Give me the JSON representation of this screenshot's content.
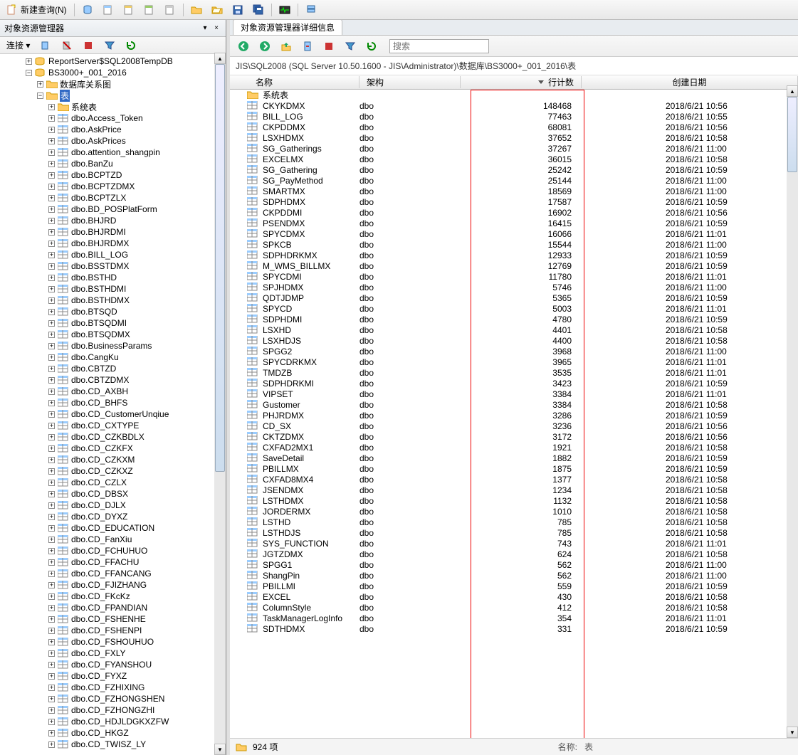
{
  "toolbar": {
    "new_query": "新建查询(N)"
  },
  "object_explorer": {
    "title": "对象资源管理器",
    "connect_label": "连接 ▾",
    "top_db": "ReportServer$SQL2008TempDB",
    "main_db": "BS3000+_001_2016",
    "diagram_folder": "数据库关系图",
    "tables_folder": "表",
    "sys_tables": "系统表",
    "items": [
      "dbo.Access_Token",
      "dbo.AskPrice",
      "dbo.AskPrices",
      "dbo.attention_shangpin",
      "dbo.BanZu",
      "dbo.BCPTZD",
      "dbo.BCPTZDMX",
      "dbo.BCPTZLX",
      "dbo.BD_POSPlatForm",
      "dbo.BHJRD",
      "dbo.BHJRDMI",
      "dbo.BHJRDMX",
      "dbo.BILL_LOG",
      "dbo.BSSTDMX",
      "dbo.BSTHD",
      "dbo.BSTHDMI",
      "dbo.BSTHDMX",
      "dbo.BTSQD",
      "dbo.BTSQDMI",
      "dbo.BTSQDMX",
      "dbo.BusinessParams",
      "dbo.CangKu",
      "dbo.CBTZD",
      "dbo.CBTZDMX",
      "dbo.CD_AXBH",
      "dbo.CD_BHFS",
      "dbo.CD_CustomerUnqiue",
      "dbo.CD_CXTYPE",
      "dbo.CD_CZKBDLX",
      "dbo.CD_CZKFX",
      "dbo.CD_CZKXM",
      "dbo.CD_CZKXZ",
      "dbo.CD_CZLX",
      "dbo.CD_DBSX",
      "dbo.CD_DJLX",
      "dbo.CD_DYXZ",
      "dbo.CD_EDUCATION",
      "dbo.CD_FanXiu",
      "dbo.CD_FCHUHUO",
      "dbo.CD_FFACHU",
      "dbo.CD_FFANCANG",
      "dbo.CD_FJIZHANG",
      "dbo.CD_FKcKz",
      "dbo.CD_FPANDIAN",
      "dbo.CD_FSHENHE",
      "dbo.CD_FSHENPI",
      "dbo.CD_FSHOUHUO",
      "dbo.CD_FXLY",
      "dbo.CD_FYANSHOU",
      "dbo.CD_FYXZ",
      "dbo.CD_FZHIXING",
      "dbo.CD_FZHONGSHEN",
      "dbo.CD_FZHONGZHI",
      "dbo.CD_HDJLDGKXZFW",
      "dbo.CD_HKGZ",
      "dbo.CD_TWISZ_LY"
    ]
  },
  "detail": {
    "tab_title": "对象资源管理器详细信息",
    "search_placeholder": "搜索",
    "breadcrumb": "JIS\\SQL2008 (SQL Server 10.50.1600 - JIS\\Administrator)\\数据库\\BS3000+_001_2016\\表",
    "columns": {
      "name": "名称",
      "schema": "架构",
      "rows": "行计数",
      "date": "创建日期"
    },
    "system_table_row": "系统表",
    "table_rows": [
      {
        "n": "CKYKDMX",
        "s": "dbo",
        "r": "148468",
        "d": "2018/6/21 10:56"
      },
      {
        "n": "BILL_LOG",
        "s": "dbo",
        "r": "77463",
        "d": "2018/6/21 10:55"
      },
      {
        "n": "CKPDDMX",
        "s": "dbo",
        "r": "68081",
        "d": "2018/6/21 10:56"
      },
      {
        "n": "LSXHDMX",
        "s": "dbo",
        "r": "37652",
        "d": "2018/6/21 10:58"
      },
      {
        "n": "SG_Gatherings",
        "s": "dbo",
        "r": "37267",
        "d": "2018/6/21 11:00"
      },
      {
        "n": "EXCELMX",
        "s": "dbo",
        "r": "36015",
        "d": "2018/6/21 10:58"
      },
      {
        "n": "SG_Gathering",
        "s": "dbo",
        "r": "25242",
        "d": "2018/6/21 10:59"
      },
      {
        "n": "SG_PayMethod",
        "s": "dbo",
        "r": "25144",
        "d": "2018/6/21 11:00"
      },
      {
        "n": "SMARTMX",
        "s": "dbo",
        "r": "18569",
        "d": "2018/6/21 11:00"
      },
      {
        "n": "SDPHDMX",
        "s": "dbo",
        "r": "17587",
        "d": "2018/6/21 10:59"
      },
      {
        "n": "CKPDDMI",
        "s": "dbo",
        "r": "16902",
        "d": "2018/6/21 10:56"
      },
      {
        "n": "PSENDMX",
        "s": "dbo",
        "r": "16415",
        "d": "2018/6/21 10:59"
      },
      {
        "n": "SPYCDMX",
        "s": "dbo",
        "r": "16066",
        "d": "2018/6/21 11:01"
      },
      {
        "n": "SPKCB",
        "s": "dbo",
        "r": "15544",
        "d": "2018/6/21 11:00"
      },
      {
        "n": "SDPHDRKMX",
        "s": "dbo",
        "r": "12933",
        "d": "2018/6/21 10:59"
      },
      {
        "n": "M_WMS_BILLMX",
        "s": "dbo",
        "r": "12769",
        "d": "2018/6/21 10:59"
      },
      {
        "n": "SPYCDMI",
        "s": "dbo",
        "r": "11780",
        "d": "2018/6/21 11:01"
      },
      {
        "n": "SPJHDMX",
        "s": "dbo",
        "r": "5746",
        "d": "2018/6/21 11:00"
      },
      {
        "n": "QDTJDMP",
        "s": "dbo",
        "r": "5365",
        "d": "2018/6/21 10:59"
      },
      {
        "n": "SPYCD",
        "s": "dbo",
        "r": "5003",
        "d": "2018/6/21 11:01"
      },
      {
        "n": "SDPHDMI",
        "s": "dbo",
        "r": "4780",
        "d": "2018/6/21 10:59"
      },
      {
        "n": "LSXHD",
        "s": "dbo",
        "r": "4401",
        "d": "2018/6/21 10:58"
      },
      {
        "n": "LSXHDJS",
        "s": "dbo",
        "r": "4400",
        "d": "2018/6/21 10:58"
      },
      {
        "n": "SPGG2",
        "s": "dbo",
        "r": "3968",
        "d": "2018/6/21 11:00"
      },
      {
        "n": "SPYCDRKMX",
        "s": "dbo",
        "r": "3965",
        "d": "2018/6/21 11:01"
      },
      {
        "n": "TMDZB",
        "s": "dbo",
        "r": "3535",
        "d": "2018/6/21 11:01"
      },
      {
        "n": "SDPHDRKMI",
        "s": "dbo",
        "r": "3423",
        "d": "2018/6/21 10:59"
      },
      {
        "n": "VIPSET",
        "s": "dbo",
        "r": "3384",
        "d": "2018/6/21 11:01"
      },
      {
        "n": "Gustomer",
        "s": "dbo",
        "r": "3384",
        "d": "2018/6/21 10:58"
      },
      {
        "n": "PHJRDMX",
        "s": "dbo",
        "r": "3286",
        "d": "2018/6/21 10:59"
      },
      {
        "n": "CD_SX",
        "s": "dbo",
        "r": "3236",
        "d": "2018/6/21 10:56"
      },
      {
        "n": "CKTZDMX",
        "s": "dbo",
        "r": "3172",
        "d": "2018/6/21 10:56"
      },
      {
        "n": "CXFAD2MX1",
        "s": "dbo",
        "r": "1921",
        "d": "2018/6/21 10:58"
      },
      {
        "n": "SaveDetail",
        "s": "dbo",
        "r": "1882",
        "d": "2018/6/21 10:59"
      },
      {
        "n": "PBILLMX",
        "s": "dbo",
        "r": "1875",
        "d": "2018/6/21 10:59"
      },
      {
        "n": "CXFAD8MX4",
        "s": "dbo",
        "r": "1377",
        "d": "2018/6/21 10:58"
      },
      {
        "n": "JSENDMX",
        "s": "dbo",
        "r": "1234",
        "d": "2018/6/21 10:58"
      },
      {
        "n": "LSTHDMX",
        "s": "dbo",
        "r": "1132",
        "d": "2018/6/21 10:58"
      },
      {
        "n": "JORDERMX",
        "s": "dbo",
        "r": "1010",
        "d": "2018/6/21 10:58"
      },
      {
        "n": "LSTHD",
        "s": "dbo",
        "r": "785",
        "d": "2018/6/21 10:58"
      },
      {
        "n": "LSTHDJS",
        "s": "dbo",
        "r": "785",
        "d": "2018/6/21 10:58"
      },
      {
        "n": "SYS_FUNCTION",
        "s": "dbo",
        "r": "743",
        "d": "2018/6/21 11:01"
      },
      {
        "n": "JGTZDMX",
        "s": "dbo",
        "r": "624",
        "d": "2018/6/21 10:58"
      },
      {
        "n": "SPGG1",
        "s": "dbo",
        "r": "562",
        "d": "2018/6/21 11:00"
      },
      {
        "n": "ShangPin",
        "s": "dbo",
        "r": "562",
        "d": "2018/6/21 11:00"
      },
      {
        "n": "PBILLMI",
        "s": "dbo",
        "r": "559",
        "d": "2018/6/21 10:59"
      },
      {
        "n": "EXCEL",
        "s": "dbo",
        "r": "430",
        "d": "2018/6/21 10:58"
      },
      {
        "n": "ColumnStyle",
        "s": "dbo",
        "r": "412",
        "d": "2018/6/21 10:58"
      },
      {
        "n": "TaskManagerLogInfo",
        "s": "dbo",
        "r": "354",
        "d": "2018/6/21 11:01"
      },
      {
        "n": "SDTHDMX",
        "s": "dbo",
        "r": "331",
        "d": "2018/6/21 10:59"
      }
    ],
    "status": {
      "count": "924 项",
      "name_label": "名称:",
      "name_value": "表"
    }
  }
}
